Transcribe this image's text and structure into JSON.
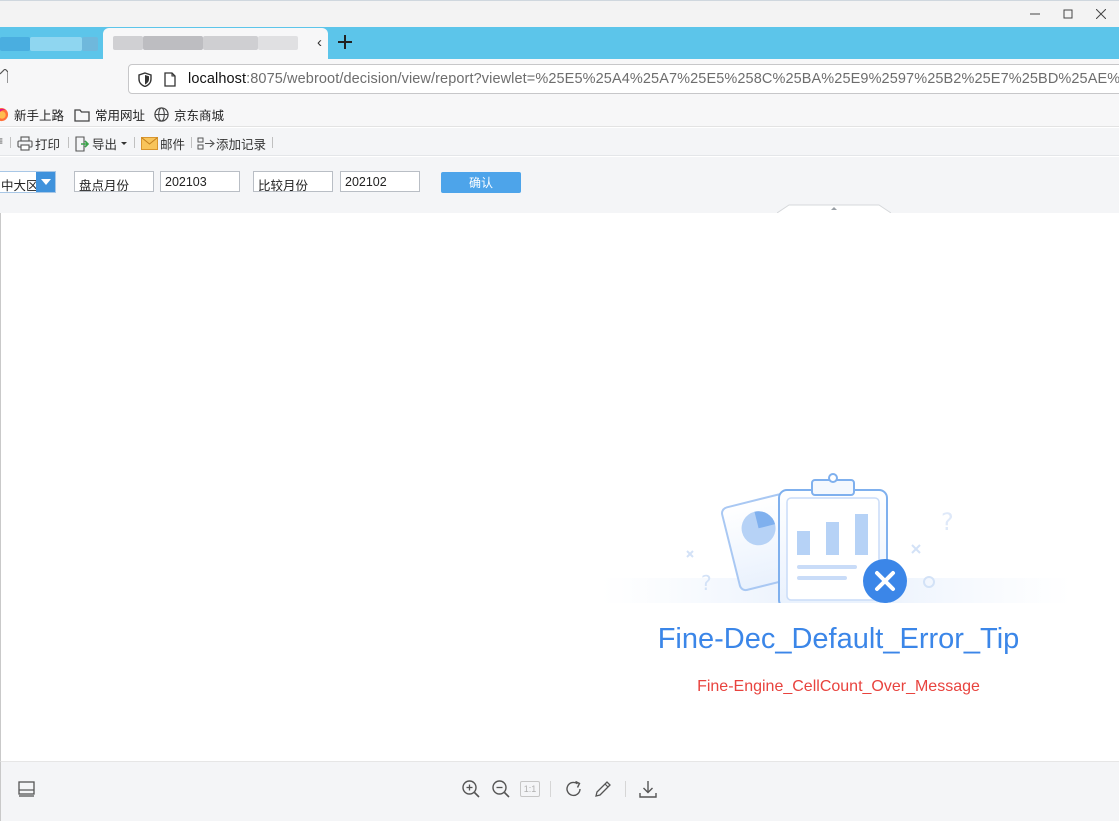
{
  "browser": {
    "url_host": "localhost",
    "url_rest": ":8075/webroot/decision/view/report?viewlet=%25E5%25A4%25A7%25E5%258C%25BA%25E9%2597%25B2%25E7%25BD%25AE%25",
    "bookmarks": [
      {
        "label": "新手上路",
        "icon": "firefox-icon"
      },
      {
        "label": "常用网址",
        "icon": "folder-icon"
      },
      {
        "label": "京东商城",
        "icon": "globe-icon"
      }
    ]
  },
  "report_toolbar": {
    "print_label": "打印",
    "export_label": "导出",
    "mail_label": "邮件",
    "add_record_label": "添加记录"
  },
  "params": {
    "region_value": "中大区",
    "inventory_month_label": "盘点月份",
    "inventory_month_value": "202103",
    "compare_month_label": "比较月份",
    "compare_month_value": "202102",
    "confirm_label": "确认"
  },
  "error": {
    "title": "Fine-Dec_Default_Error_Tip",
    "message": "Fine-Engine_CellCount_Over_Message"
  },
  "bottom_toolbar": {
    "page_ratio_label": "1:1"
  },
  "colors": {
    "tabbar": "#5cc5ea",
    "accent_blue": "#3b86e8",
    "error_red": "#e8433e",
    "confirm_button": "#4da4ea"
  }
}
